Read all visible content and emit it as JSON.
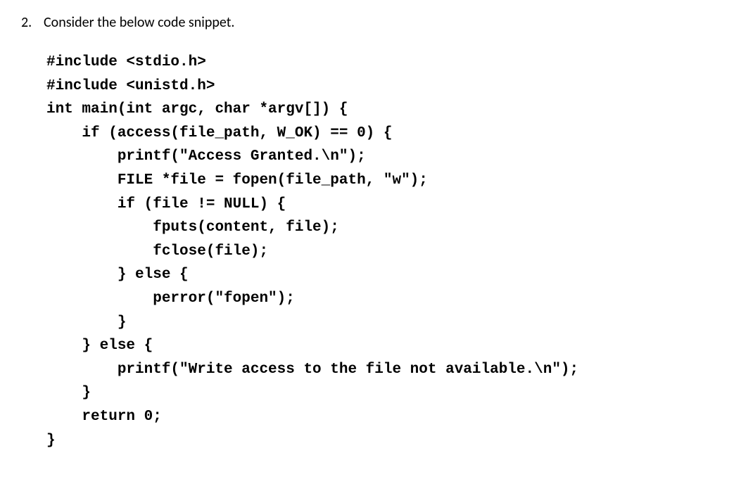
{
  "question": {
    "number": "2.",
    "prompt": "Consider the below code snippet."
  },
  "code_lines": [
    "#include <stdio.h>",
    "#include <unistd.h>",
    "int main(int argc, char *argv[]) {",
    "    if (access(file_path, W_OK) == 0) {",
    "        printf(\"Access Granted.\\n\");",
    "        FILE *file = fopen(file_path, \"w\");",
    "        if (file != NULL) {",
    "            fputs(content, file);",
    "            fclose(file);",
    "        } else {",
    "            perror(\"fopen\");",
    "        }",
    "    } else {",
    "        printf(\"Write access to the file not available.\\n\");",
    "    }",
    "    return 0;",
    "}"
  ]
}
